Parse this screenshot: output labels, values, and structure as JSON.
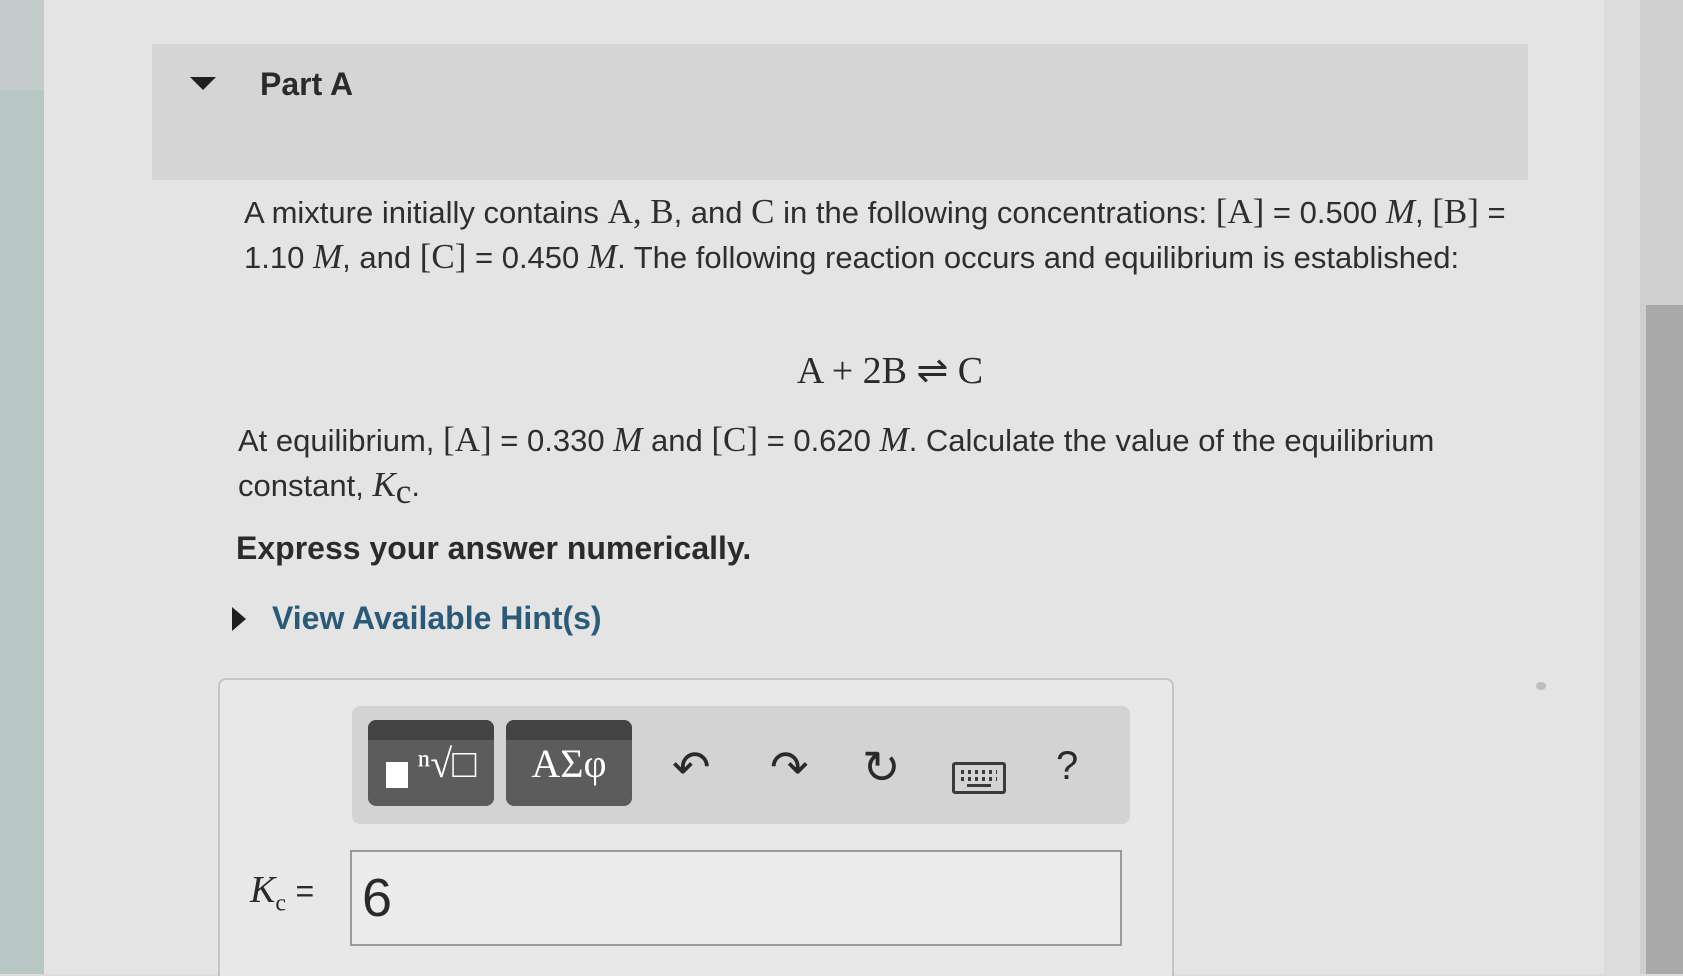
{
  "part": {
    "title": "Part A"
  },
  "problem": {
    "intro": "A mixture initially contains",
    "A": "A",
    "comma1": ",",
    "B": "B",
    "and1": ", and",
    "C": "C",
    "intro2": "in the following concentrations:",
    "A_bracket": "[A]",
    "A_eq": "= 0.500",
    "M": "M",
    "B_bracket": "[B]",
    "B_eq": "= 1.10",
    "and2": ", and",
    "C_bracket": "[C]",
    "C_eq": "= 0.450",
    "intro3": ". The following reaction occurs and equilibrium is established:",
    "reaction": "A + 2B ⇌ C",
    "equil_prefix": "At equilibrium,",
    "equil_A": "= 0.330",
    "equil_and": "and",
    "equil_C": "= 0.620",
    "equil_suffix": ". Calculate the value of the equilibrium constant,",
    "K": "K",
    "c": "c",
    "period": "."
  },
  "instruction": "Express your answer numerically.",
  "hints": {
    "label": "View Available Hint(s)"
  },
  "toolbar": {
    "templates_root": "ⁿ√□",
    "symbols_label": "ΑΣφ",
    "undo": "↶",
    "redo": "↷",
    "reset": "↻",
    "help": "?"
  },
  "answer": {
    "label_K": "K",
    "label_c": "c",
    "label_eq": "=",
    "value": "6"
  }
}
